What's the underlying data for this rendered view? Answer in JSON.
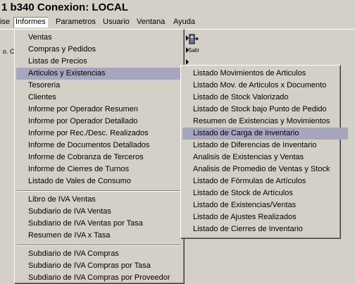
{
  "window": {
    "title": "1 b340 Conexion: LOCAL"
  },
  "menubar": [
    {
      "label": "ise",
      "active": false
    },
    {
      "label": "Informes",
      "active": true
    },
    {
      "label": "Parametros",
      "active": false
    },
    {
      "label": "Usuario",
      "active": false
    },
    {
      "label": "Ventana",
      "active": false
    },
    {
      "label": "Ayuda",
      "active": false
    }
  ],
  "toolbar": {
    "left_label": "o. C",
    "exit_label": "Salir"
  },
  "informes_menu": {
    "group1": [
      {
        "label": "Ventas",
        "submenu": true
      },
      {
        "label": "Compras y Pedidos",
        "submenu": true
      },
      {
        "label": "Listas de Precios",
        "submenu": true
      },
      {
        "label": "Articulos y Existencias",
        "submenu": true,
        "highlighted": true
      },
      {
        "label": "Tesoreria",
        "submenu": true
      },
      {
        "label": "Clientes",
        "submenu": true
      },
      {
        "label": "Informe por Operador Resumen"
      },
      {
        "label": "Informe por Operador Detallado"
      },
      {
        "label": "Informe por Rec./Desc. Realizados"
      },
      {
        "label": "Informe de Documentos Detallados"
      },
      {
        "label": "Informe de Cobranza de Terceros"
      },
      {
        "label": "Informe de Cierres de Turnos"
      },
      {
        "label": "Listado de Vales de Consumo"
      }
    ],
    "group2": [
      {
        "label": "Libro de IVA Ventas"
      },
      {
        "label": "Subdiario de IVA Ventas"
      },
      {
        "label": "Subdiario de IVA Ventas por Tasa"
      },
      {
        "label": "Resumen de IVA x Tasa"
      }
    ],
    "group3": [
      {
        "label": "Subdiario de IVA Compras"
      },
      {
        "label": "Subdiario de IVA Compras por Tasa"
      },
      {
        "label": "Subdiario de IVA Compras por Proveedor"
      }
    ]
  },
  "articulos_submenu": [
    {
      "label": "Listado Movimientos de Articulos"
    },
    {
      "label": "Listado Mov. de Articulos x Documento"
    },
    {
      "label": "Listado de Stock Valorizado"
    },
    {
      "label": "Listado de Stock bajo Punto de Pedido"
    },
    {
      "label": "Resumen de Existencias y Movimientos"
    },
    {
      "label": "Listado de Carga de Inventario",
      "highlighted": true
    },
    {
      "label": "Listado de Diferencias de Inventario"
    },
    {
      "label": "Analisis de Existencias y Ventas"
    },
    {
      "label": "Analisis de Promedio de Ventas y Stock"
    },
    {
      "label": "Listado de Fórmulas de Artículos"
    },
    {
      "label": "Listado de Stock de Artículos"
    },
    {
      "label": "Listado de Existencias/Ventas"
    },
    {
      "label": "Listado de Ajustes Realizados"
    },
    {
      "label": "Listado de Cierres de Inventario"
    }
  ],
  "colors": {
    "face": "#d4d0c8",
    "highlight": "#a6a6bf"
  }
}
